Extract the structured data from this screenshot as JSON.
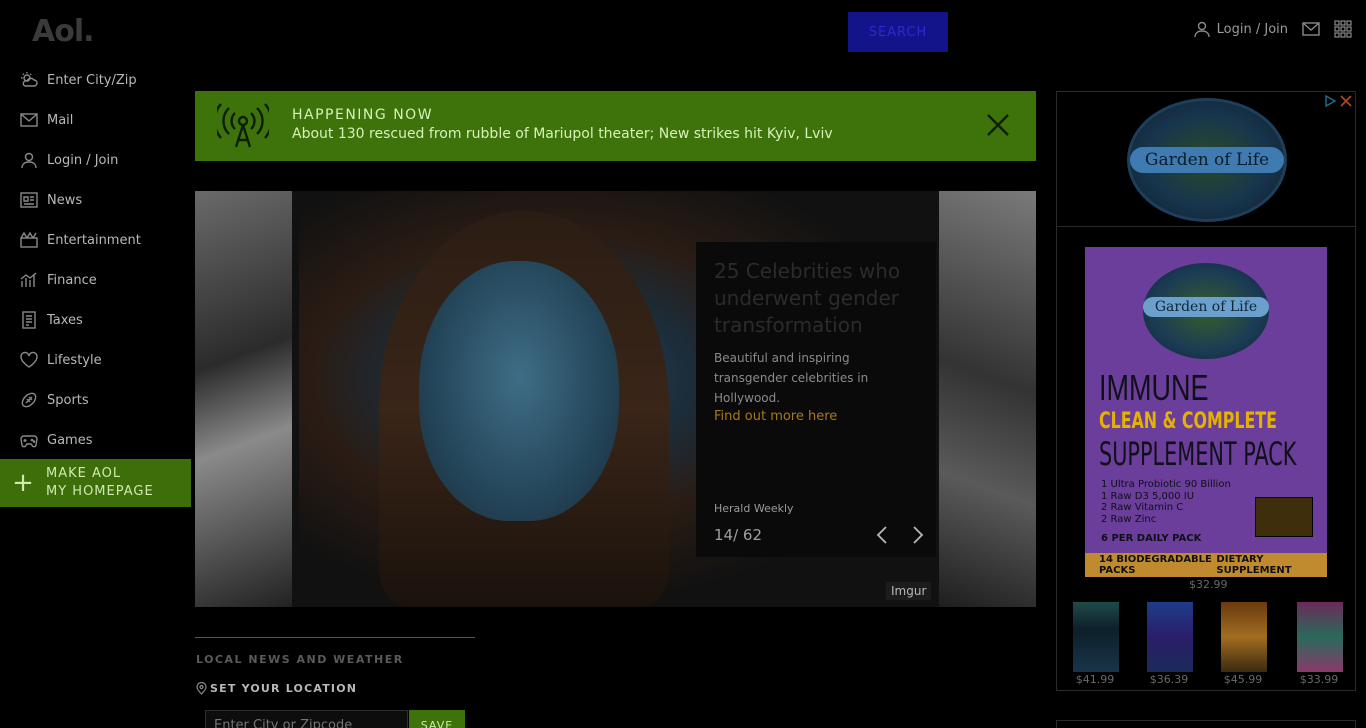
{
  "header": {
    "logo": "Aol.",
    "search_placeholder": "",
    "search_button": "SEARCH",
    "login": "Login / Join"
  },
  "sidebar": {
    "items": [
      {
        "label": "Enter City/Zip",
        "icon": "weather-icon"
      },
      {
        "label": "Mail",
        "icon": "mail-icon"
      },
      {
        "label": "Login / Join",
        "icon": "user-icon"
      },
      {
        "label": "News",
        "icon": "news-icon"
      },
      {
        "label": "Entertainment",
        "icon": "entertainment-icon"
      },
      {
        "label": "Finance",
        "icon": "finance-icon"
      },
      {
        "label": "Taxes",
        "icon": "taxes-icon"
      },
      {
        "label": "Lifestyle",
        "icon": "heart-icon"
      },
      {
        "label": "Sports",
        "icon": "football-icon"
      },
      {
        "label": "Games",
        "icon": "gamepad-icon"
      }
    ],
    "make_home_line1": "MAKE AOL",
    "make_home_line2": "MY HOMEPAGE"
  },
  "banner": {
    "tag": "HAPPENING NOW",
    "headline": "About 130 rescued from rubble of Mariupol theater; New strikes hit Kyiv, Lviv"
  },
  "carousel": {
    "title": "25 Celebrities who underwent gender transformation",
    "description": "Beautiful and inspiring transgender celebrities in Hollywood.",
    "link": "Find out more here",
    "source": "Herald Weekly",
    "counter": "14/ 62",
    "credit": "Imgur"
  },
  "local": {
    "title": "LOCAL NEWS AND WEATHER",
    "set_location": "SET YOUR LOCATION",
    "input_placeholder": "Enter City or Zipcode",
    "save": "SAVE"
  },
  "ad": {
    "brand": "Garden of Life",
    "pack_title": "IMMUNE",
    "pack_sub1": "CLEAN & COMPLETE",
    "pack_sub2": "SUPPLEMENT PACK",
    "pack_list": [
      "1  Ultra Probiotic 90 Billion",
      "1  Raw D3 5,000 IU",
      "2  Raw Vitamin C",
      "2  Raw Zinc"
    ],
    "pack_daily": "6  PER DAILY PACK",
    "pack_bottom_left": "14 BIODEGRADABLE PACKS",
    "pack_bottom_right": "DIETARY SUPPLEMENT",
    "main_price": "$32.99",
    "products": [
      {
        "price": "$41.99"
      },
      {
        "price": "$36.39"
      },
      {
        "price": "$45.99"
      },
      {
        "price": "$33.99"
      }
    ]
  }
}
